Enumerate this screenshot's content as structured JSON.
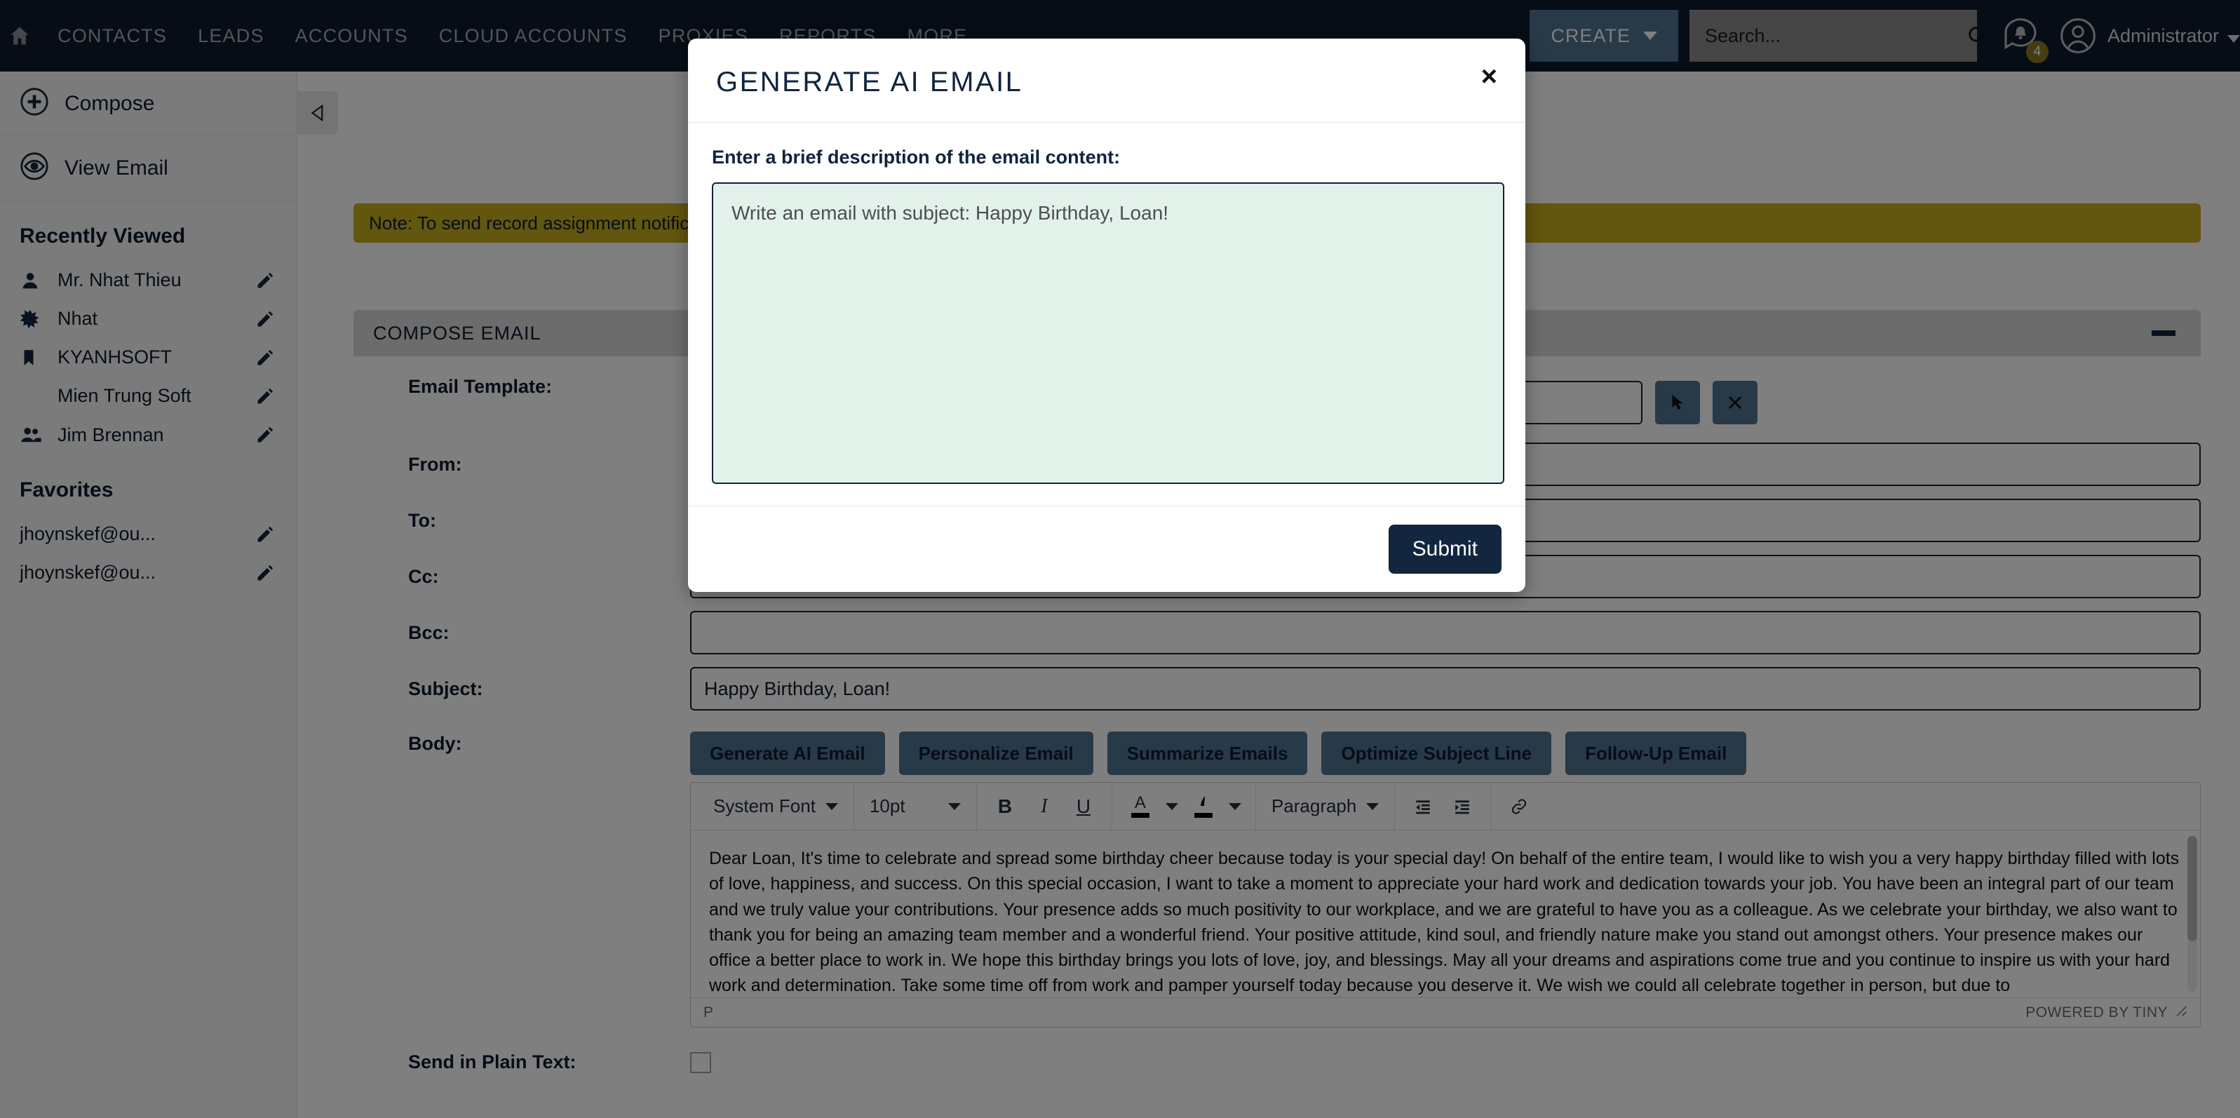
{
  "topnav": {
    "home_icon": "home-icon",
    "links": [
      "CONTACTS",
      "LEADS",
      "ACCOUNTS",
      "CLOUD ACCOUNTS",
      "PROXIES",
      "REPORTS",
      "MORE"
    ],
    "create_label": "CREATE",
    "search_placeholder": "Search...",
    "notifications_count": "4",
    "user_name": "Administrator"
  },
  "sidebar": {
    "actions": [
      {
        "label": "Compose",
        "icon": "plus-circle-icon"
      },
      {
        "label": "View Email",
        "icon": "eye-circle-icon"
      }
    ],
    "recently_viewed_heading": "Recently Viewed",
    "recently_viewed": [
      {
        "label": "Mr. Nhat Thieu",
        "icon": "person-icon"
      },
      {
        "label": "Nhat",
        "icon": "star-burst-icon"
      },
      {
        "label": "KYANHSOFT",
        "icon": "bookmark-icon"
      },
      {
        "label": "Mien Trung Soft",
        "icon": "none"
      },
      {
        "label": "Jim Brennan",
        "icon": "people-icon"
      }
    ],
    "favorites_heading": "Favorites",
    "favorites": [
      {
        "label": "jhoynskef@ou...",
        "icon": "none"
      },
      {
        "label": "jhoynskef@ou...",
        "icon": "none"
      }
    ],
    "edit_icon": "pencil-icon"
  },
  "main": {
    "collapse_tab_icon": "triangle-left-icon",
    "note": "Note: To send record assignment notifications, you must configure an outgoing mail server.",
    "panel_title": "COMPOSE EMAIL",
    "panel_collapse_icon": "minus-icon",
    "labels": {
      "email_template": "Email Template:",
      "from": "From:",
      "to": "To:",
      "cc": "Cc:",
      "bcc": "Bcc:",
      "subject": "Subject:",
      "body": "Body:",
      "plain_text": "Send in Plain Text:"
    },
    "values": {
      "email_template": "",
      "template_name": "",
      "from": "",
      "to": "",
      "cc": "",
      "bcc": "",
      "subject": "Happy Birthday, Loan!"
    },
    "template_buttons": {
      "select_icon": "arrow-pointer-icon",
      "clear_icon": "x-icon"
    },
    "ai_buttons": [
      "Generate AI Email",
      "Personalize Email",
      "Summarize Emails",
      "Optimize Subject Line",
      "Follow-Up Email"
    ],
    "editor": {
      "font_family": "System Font",
      "font_size": "10pt",
      "bold": "B",
      "italic": "I",
      "underline": "U",
      "text_color": "A",
      "highlight_color": "highlighter-icon",
      "block_format": "Paragraph",
      "outdent": "outdent-icon",
      "indent": "indent-icon",
      "link": "link-icon",
      "body_text": "Dear Loan, It's time to celebrate and spread some birthday cheer because today is your special day! On behalf of the entire team, I would like to wish you a very happy birthday filled with lots of love, happiness, and success. On this special occasion, I want to take a moment to appreciate your hard work and dedication towards your job. You have been an integral part of our team and we truly value your contributions. Your presence adds so much positivity to our workplace, and we are grateful to have you as a colleague. As we celebrate your birthday, we also want to thank you for being an amazing team member and a wonderful friend. Your positive attitude, kind soul, and friendly nature make you stand out amongst others. Your presence makes our office a better place to work in. We hope this birthday brings you lots of love, joy, and blessings. May all your dreams and aspirations come true and you continue to inspire us with your hard work and determination. Take some time off from work and pamper yourself today because you deserve it. We wish we could all celebrate together in person, but due to",
      "status_path": "P",
      "status_brand": "POWERED BY TINY"
    }
  },
  "modal": {
    "title": "GENERATE AI EMAIL",
    "close_label": "×",
    "field_label": "Enter a brief description of the email content:",
    "textarea_value": "Write an email with subject: Happy Birthday, Loan!",
    "submit_label": "Submit"
  },
  "colors": {
    "nav_bg": "#0d1b2d",
    "accent_blue": "#517390",
    "note_yellow": "#c6ad1d",
    "submit_navy": "#12263f",
    "textarea_green": "#e2f2ea"
  }
}
